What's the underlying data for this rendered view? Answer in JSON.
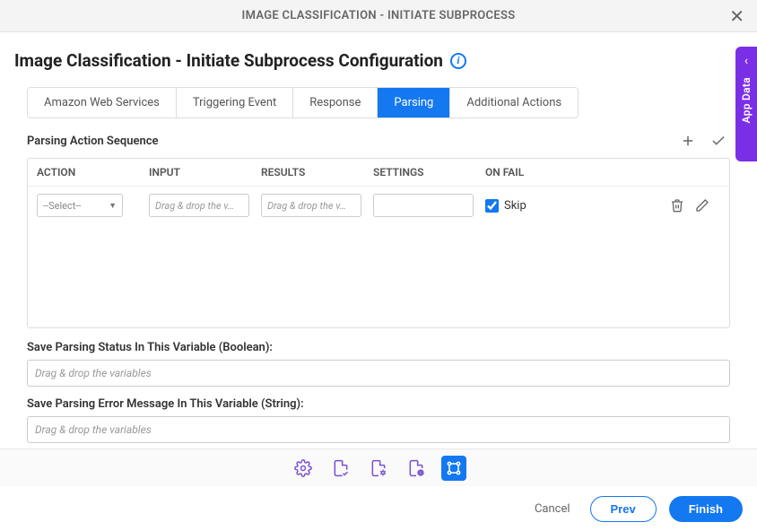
{
  "header": {
    "title": "IMAGE CLASSIFICATION - INITIATE SUBPROCESS"
  },
  "page": {
    "title": "Image Classification - Initiate Subprocess Configuration"
  },
  "tabs": [
    {
      "label": "Amazon Web Services",
      "active": false
    },
    {
      "label": "Triggering Event",
      "active": false
    },
    {
      "label": "Response",
      "active": false
    },
    {
      "label": "Parsing",
      "active": true
    },
    {
      "label": "Additional Actions",
      "active": false
    }
  ],
  "parsing_section": {
    "title": "Parsing Action Sequence",
    "columns": [
      "ACTION",
      "INPUT",
      "RESULTS",
      "SETTINGS",
      "ON FAIL"
    ],
    "row": {
      "action_placeholder": "--Select--",
      "input_placeholder": "Drag & drop the v…",
      "results_placeholder": "Drag & drop the v…",
      "skip_label": "Skip",
      "skip_checked": true
    }
  },
  "status_field": {
    "label": "Save Parsing Status In This Variable (Boolean):",
    "placeholder": "Drag & drop the variables"
  },
  "error_field": {
    "label": "Save Parsing Error Message In This Variable (String):",
    "placeholder": "Drag & drop the variables"
  },
  "bottom": {
    "cancel": "Cancel",
    "prev": "Prev",
    "finish": "Finish"
  },
  "side_panel": {
    "label": "App Data"
  }
}
